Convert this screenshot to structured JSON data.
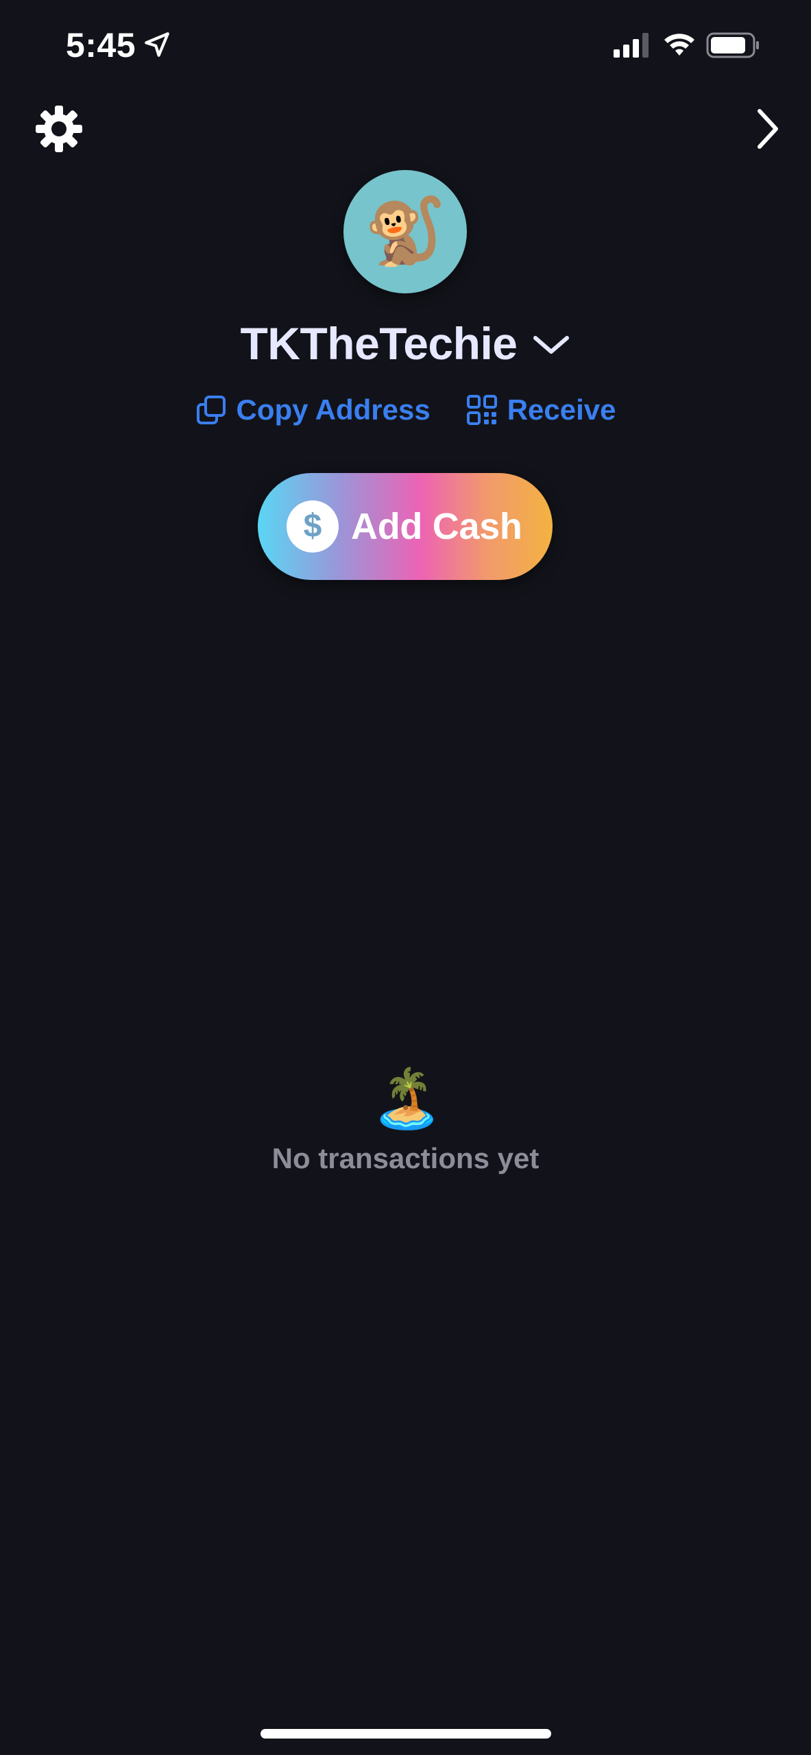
{
  "status_bar": {
    "time": "5:45",
    "icons": [
      "location-arrow-icon",
      "cellular-signal-icon",
      "wifi-icon",
      "battery-icon"
    ]
  },
  "nav": {
    "settings_icon": "gear-icon",
    "forward_icon": "chevron-right-icon"
  },
  "profile": {
    "avatar_emoji": "🐒",
    "avatar_bg": "#77c4cc",
    "account_name": "TKTheTechie",
    "switcher_icon": "chevron-down-icon"
  },
  "actions": {
    "copy_address_label": "Copy Address",
    "receive_label": "Receive",
    "link_color": "#3a7ff0"
  },
  "add_cash": {
    "icon_symbol": "$",
    "label": "Add Cash"
  },
  "empty_state": {
    "emoji": "🏝️",
    "message": "No transactions yet"
  },
  "colors": {
    "background": "#12131a",
    "name_text": "#e6e8ff",
    "muted_text": "#8c8d99"
  }
}
